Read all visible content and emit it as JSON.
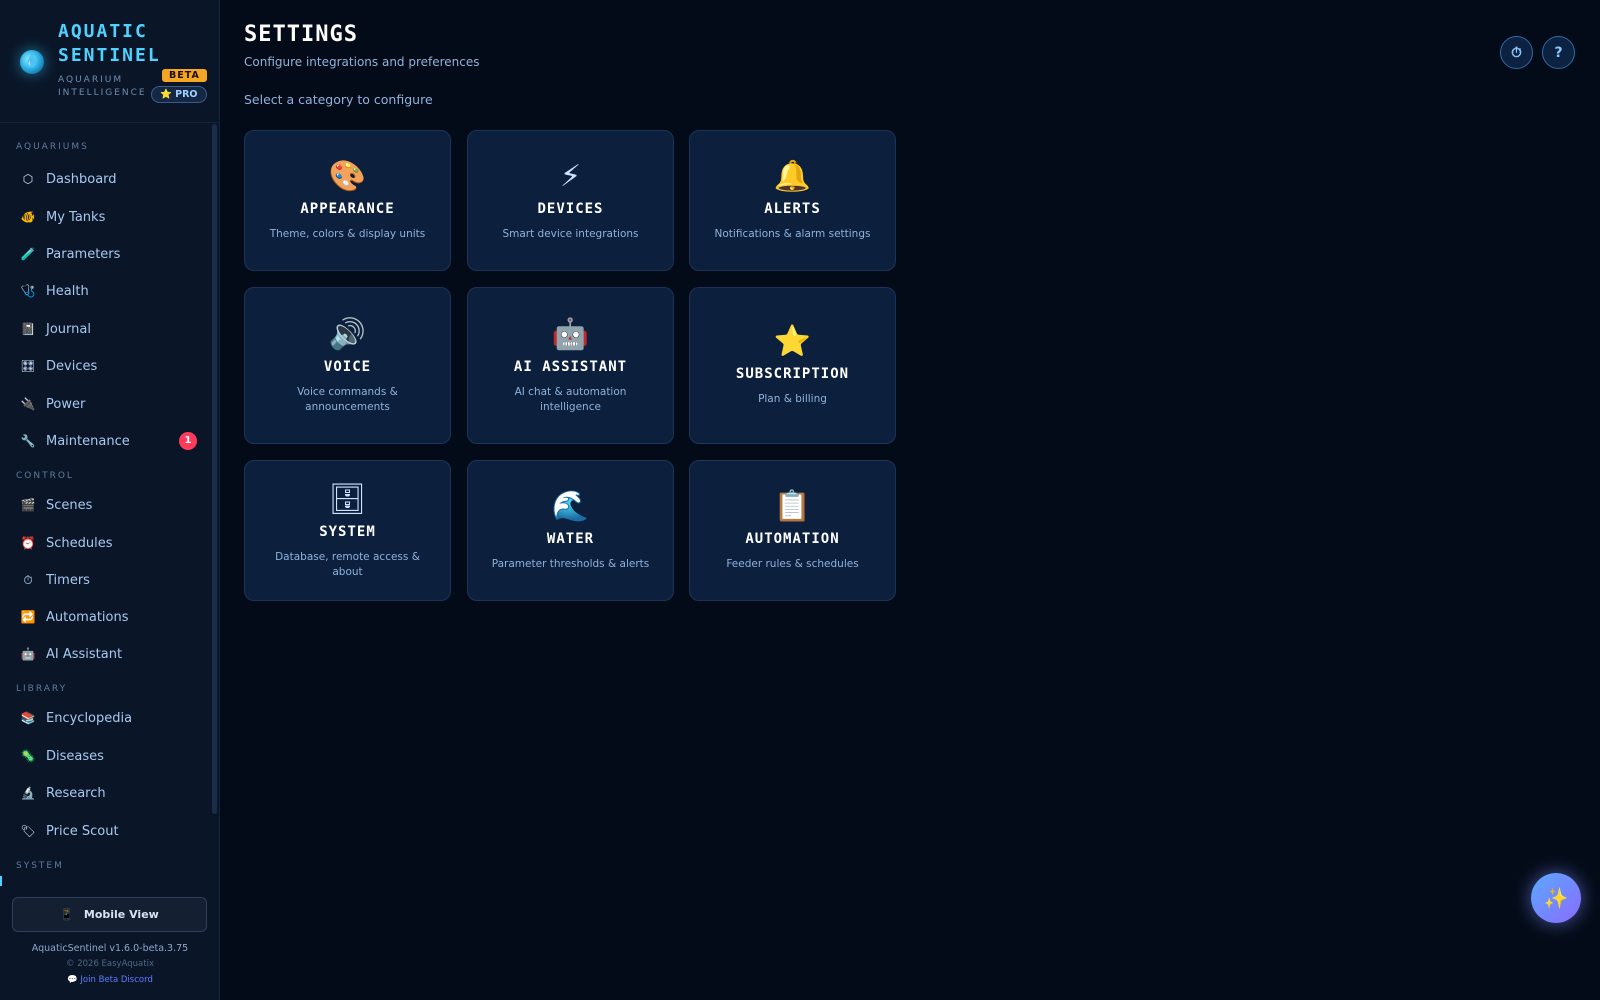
{
  "brand": {
    "title": "AQUATIC SENTINEL",
    "subtitle": "AQUARIUM INTELLIGENCE",
    "beta_label": "BETA",
    "pro_label": "⭐ PRO",
    "logo_icon": "water-drop-icon"
  },
  "sidebar": {
    "sections": {
      "aquariums": "AQUARIUMS",
      "control": "CONTROL",
      "library": "LIBRARY",
      "system": "SYSTEM"
    },
    "items": [
      {
        "label": "Dashboard",
        "icon": "⬡"
      },
      {
        "label": "My Tanks",
        "icon": "🐠"
      },
      {
        "label": "Parameters",
        "icon": "🧪"
      },
      {
        "label": "Health",
        "icon": "🩺"
      },
      {
        "label": "Journal",
        "icon": "📓"
      },
      {
        "label": "Devices",
        "icon": "🎛"
      },
      {
        "label": "Power",
        "icon": "🔌"
      },
      {
        "label": "Maintenance",
        "icon": "🔧",
        "badge": "1"
      },
      {
        "label": "Scenes",
        "icon": "🎬"
      },
      {
        "label": "Schedules",
        "icon": "⏰"
      },
      {
        "label": "Timers",
        "icon": "⏱"
      },
      {
        "label": "Automations",
        "icon": "🔁"
      },
      {
        "label": "AI Assistant",
        "icon": "🤖"
      },
      {
        "label": "Encyclopedia",
        "icon": "📚"
      },
      {
        "label": "Diseases",
        "icon": "🦠"
      },
      {
        "label": "Research",
        "icon": "🔬"
      },
      {
        "label": "Price Scout",
        "icon": "🏷"
      }
    ],
    "mobile_view_label": "Mobile View",
    "mobile_view_icon": "📱",
    "version": "AquaticSentinel v1.6.0-beta.3.75",
    "copyright": "© 2026 EasyAquatix",
    "discord": "💬 Join Beta Discord"
  },
  "header": {
    "title": "SETTINGS",
    "subtitle": "Configure integrations and preferences",
    "prompt": "Select a category to configure",
    "timer_button": "⏱",
    "help_button": "?"
  },
  "cards": [
    {
      "icon": "🎨",
      "title": "APPEARANCE",
      "desc": "Theme, colors & display units"
    },
    {
      "icon": "⚡",
      "title": "DEVICES",
      "desc": "Smart device integrations"
    },
    {
      "icon": "🔔",
      "title": "ALERTS",
      "desc": "Notifications & alarm settings"
    },
    {
      "icon": "🔊",
      "title": "VOICE",
      "desc": "Voice commands & announcements"
    },
    {
      "icon": "🤖",
      "title": "AI ASSISTANT",
      "desc": "AI chat & automation intelligence"
    },
    {
      "icon": "⭐",
      "title": "SUBSCRIPTION",
      "desc": "Plan & billing"
    },
    {
      "icon": "🗄",
      "title": "SYSTEM",
      "desc": "Database, remote access & about"
    },
    {
      "icon": "🌊",
      "title": "WATER",
      "desc": "Parameter thresholds & alerts"
    },
    {
      "icon": "📋",
      "title": "AUTOMATION",
      "desc": "Feeder rules & schedules"
    }
  ],
  "fab_icon": "✨"
}
